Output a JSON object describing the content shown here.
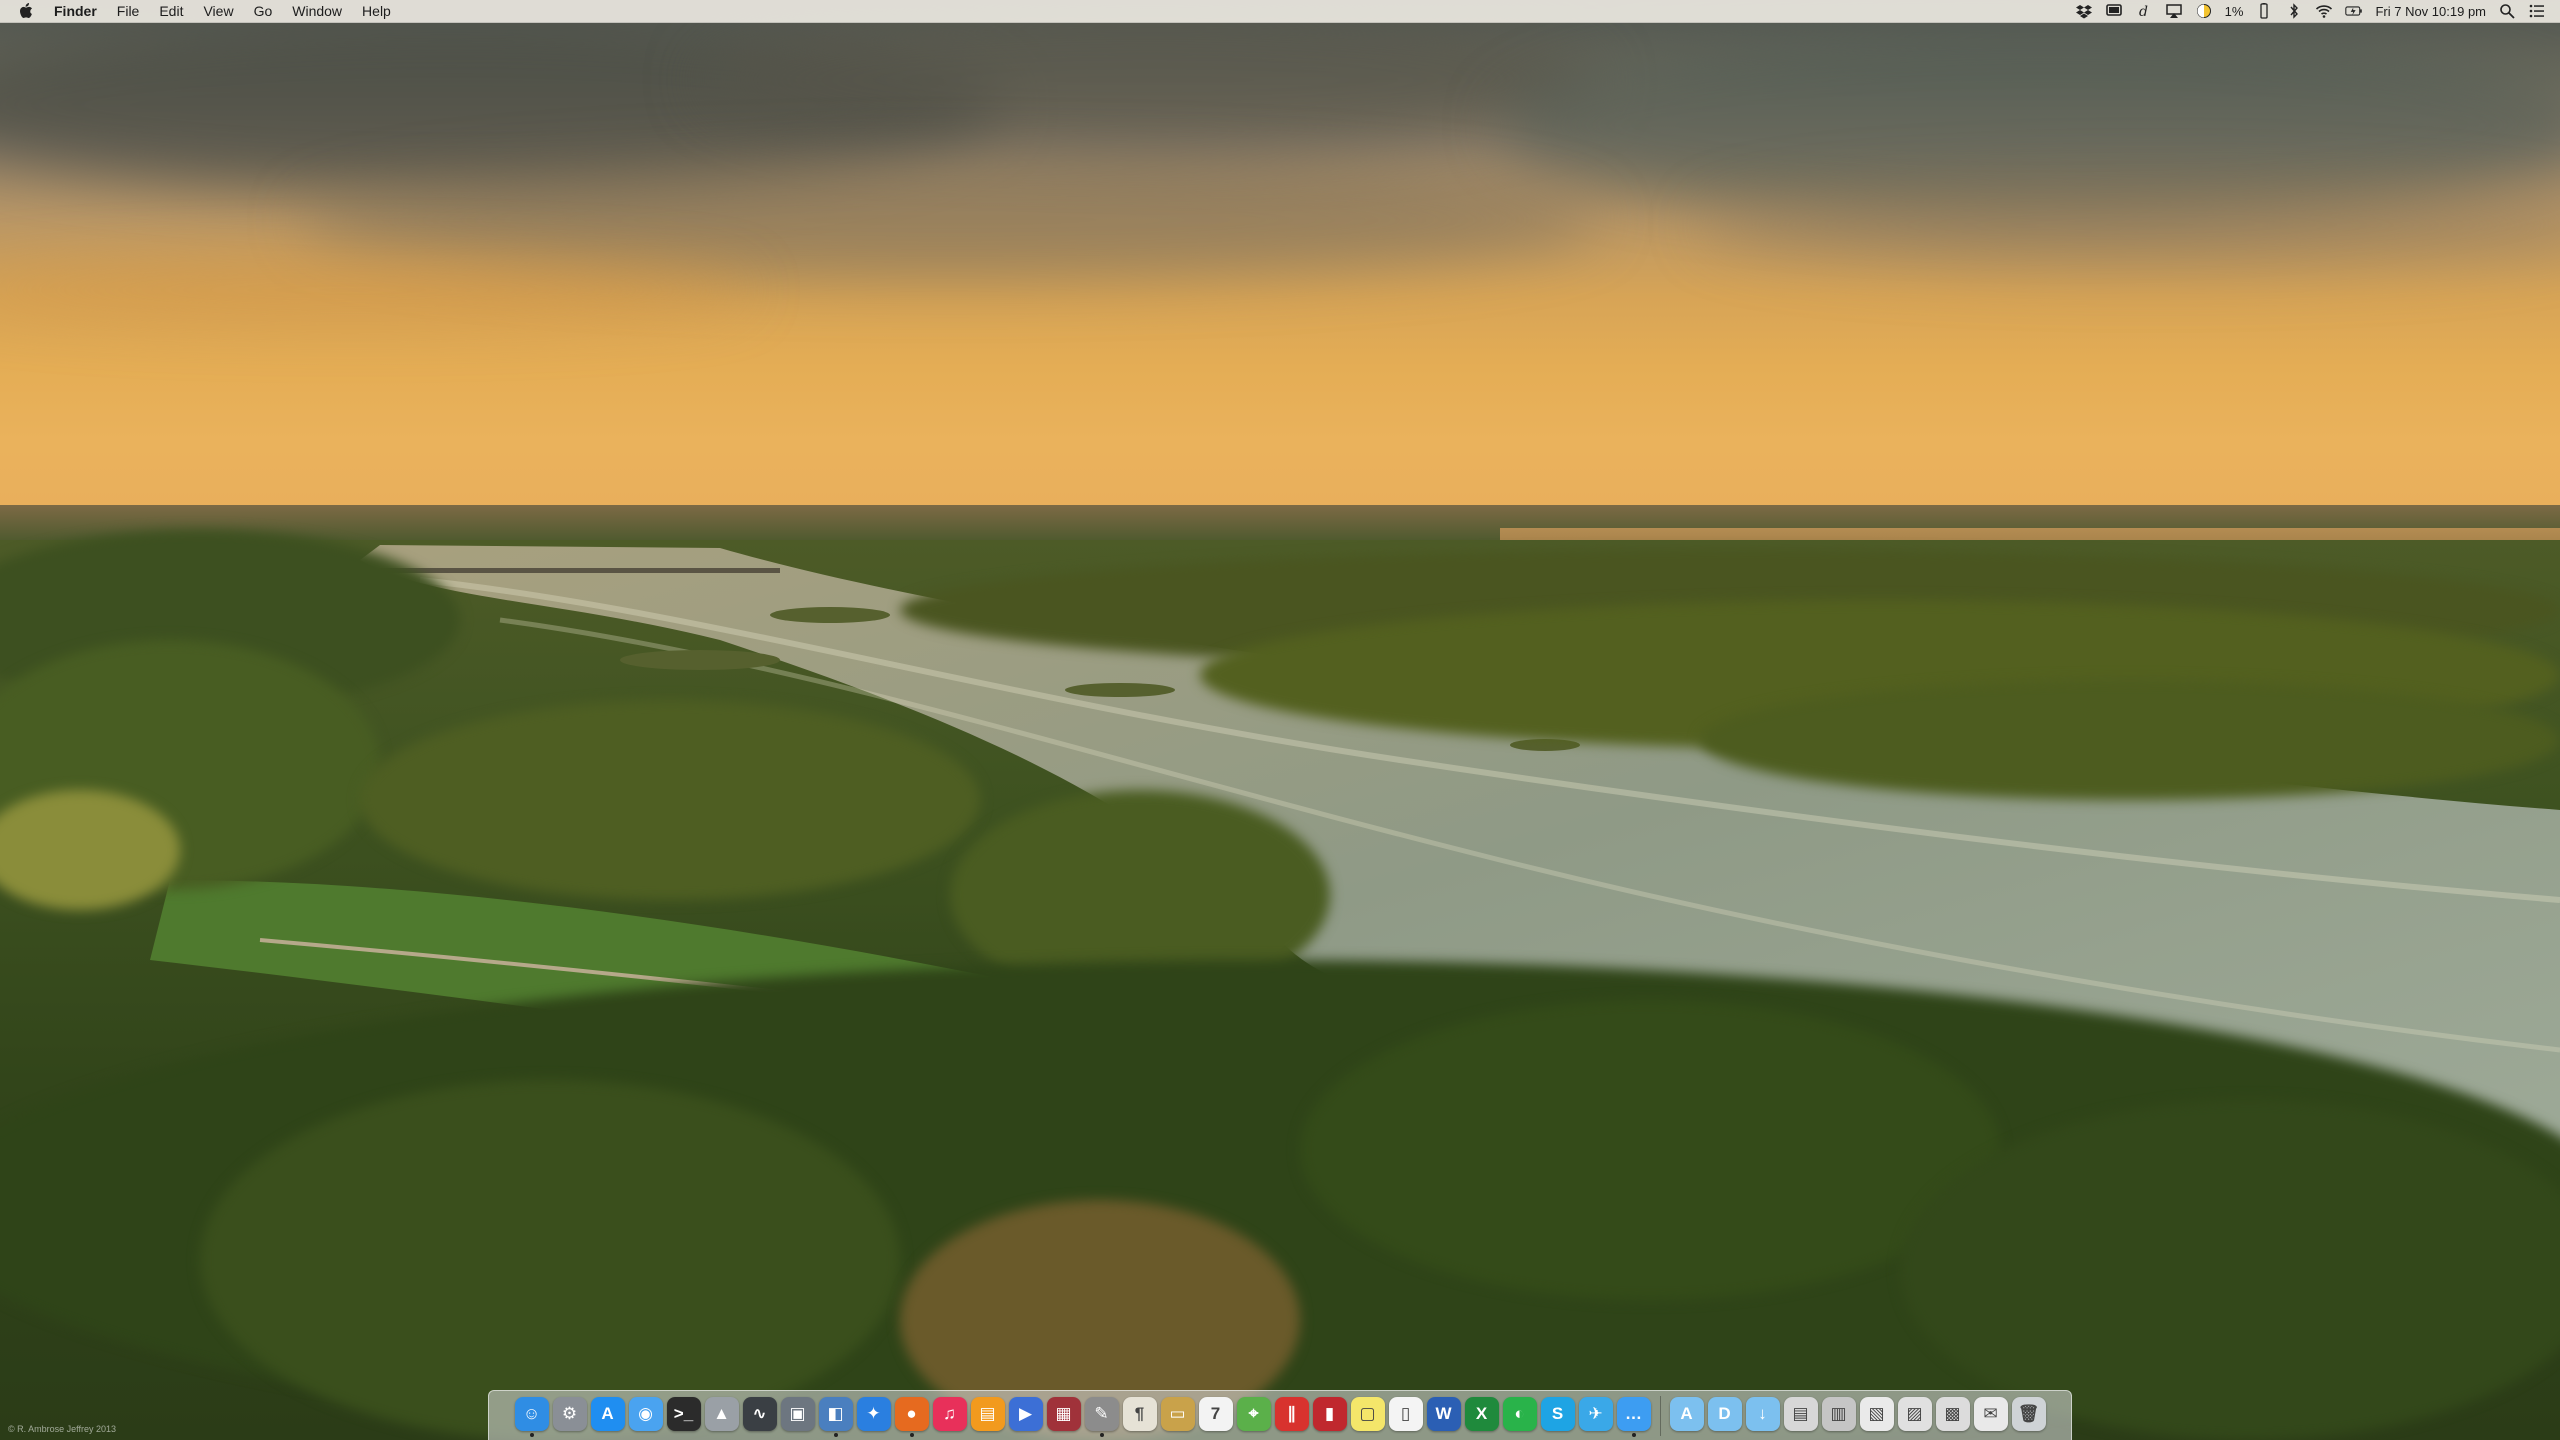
{
  "menubar": {
    "app_name": "Finder",
    "menus": [
      "File",
      "Edit",
      "View",
      "Go",
      "Window",
      "Help"
    ],
    "status": {
      "battery_percent_label": "1%",
      "datetime": "Fri 7 Nov  10:19 pm"
    },
    "status_icons": [
      "dropbox-icon",
      "display-icon",
      "dictionary-icon",
      "airplay-icon",
      "caffeine-icon",
      "battery-icon",
      "bluetooth-icon",
      "wifi-icon",
      "battery-charge-icon",
      "spotlight-icon",
      "notification-center-icon"
    ]
  },
  "wallpaper": {
    "credit": "© R. Ambrose Jeffrey 2013"
  },
  "dock": {
    "apps": [
      {
        "name": "finder-icon",
        "glyph": "☺",
        "color": "#2f8de4",
        "running": true
      },
      {
        "name": "system-preferences-icon",
        "glyph": "⚙",
        "color": "#8a8f96",
        "running": false
      },
      {
        "name": "app-store-icon",
        "glyph": "A",
        "color": "#1f8ef1",
        "running": false
      },
      {
        "name": "wireless-diagnostics-icon",
        "glyph": "◉",
        "color": "#4aa3f0",
        "running": false
      },
      {
        "name": "terminal-icon",
        "glyph": ">_",
        "color": "#2b2b2b",
        "running": false
      },
      {
        "name": "automator-icon",
        "glyph": "▲",
        "color": "#9aa0a6",
        "running": false
      },
      {
        "name": "activity-monitor-icon",
        "glyph": "∿",
        "color": "#3a3f44",
        "running": false
      },
      {
        "name": "image-capture-icon",
        "glyph": "▣",
        "color": "#6d7680",
        "running": false
      },
      {
        "name": "preview-icon",
        "glyph": "◧",
        "color": "#4a7fbf",
        "running": true
      },
      {
        "name": "safari-icon",
        "glyph": "✦",
        "color": "#2a7fe0",
        "running": false
      },
      {
        "name": "firefox-icon",
        "glyph": "●",
        "color": "#e66a1f",
        "running": true
      },
      {
        "name": "itunes-icon",
        "glyph": "♫",
        "color": "#e8305a",
        "running": false
      },
      {
        "name": "ibooks-icon",
        "glyph": "▤",
        "color": "#f29a1e",
        "running": false
      },
      {
        "name": "quicktime-icon",
        "glyph": "▶",
        "color": "#3c6fd6",
        "running": false
      },
      {
        "name": "photo-booth-icon",
        "glyph": "▦",
        "color": "#a0323a",
        "running": false
      },
      {
        "name": "utility-icon",
        "glyph": "✎",
        "color": "#8c8c8c",
        "running": true
      },
      {
        "name": "textedit-icon",
        "glyph": "¶",
        "color": "#e6e2d6",
        "running": false
      },
      {
        "name": "notes-icon",
        "glyph": "▭",
        "color": "#c9a24a",
        "running": false
      },
      {
        "name": "calendar-icon",
        "glyph": "7",
        "color": "#f3f3f3",
        "running": false
      },
      {
        "name": "maps-icon",
        "glyph": "⌖",
        "color": "#5bb04a",
        "running": false
      },
      {
        "name": "parallels-icon",
        "glyph": "∥",
        "color": "#d8322e",
        "running": false
      },
      {
        "name": "books-red-icon",
        "glyph": "▮",
        "color": "#c0282e",
        "running": false
      },
      {
        "name": "stickies-icon",
        "glyph": "▢",
        "color": "#f4e66a",
        "running": false
      },
      {
        "name": "pages-doc-icon",
        "glyph": "▯",
        "color": "#f4f4f4",
        "running": false
      },
      {
        "name": "word-icon",
        "glyph": "W",
        "color": "#2b5fb4",
        "running": false
      },
      {
        "name": "excel-icon",
        "glyph": "X",
        "color": "#1f8a3c",
        "running": false
      },
      {
        "name": "facetime-icon",
        "glyph": "◐",
        "color": "#29b34a",
        "running": false
      },
      {
        "name": "skype-icon",
        "glyph": "S",
        "color": "#1ea4e4",
        "running": false
      },
      {
        "name": "twitter-icon",
        "glyph": "✈",
        "color": "#3aa8e8",
        "running": false
      },
      {
        "name": "messages-icon",
        "glyph": "…",
        "color": "#3d9df2",
        "running": true
      },
      {
        "name": "applications-folder-icon",
        "glyph": "A",
        "color": "#7cc0ef",
        "running": false
      },
      {
        "name": "documents-folder-icon",
        "glyph": "D",
        "color": "#7cc0ef",
        "running": false
      },
      {
        "name": "downloads-folder-icon",
        "glyph": "↓",
        "color": "#7cc0ef",
        "running": false
      },
      {
        "name": "screenshot-stack-1-icon",
        "glyph": "▤",
        "color": "#d7d7d7",
        "running": false
      },
      {
        "name": "screenshot-stack-2-icon",
        "glyph": "▥",
        "color": "#c5c5c5",
        "running": false
      },
      {
        "name": "document-stack-icon",
        "glyph": "▧",
        "color": "#eaeaea",
        "running": false
      },
      {
        "name": "image-stack-icon",
        "glyph": "▨",
        "color": "#e0e0e0",
        "running": false
      },
      {
        "name": "pdf-stack-icon",
        "glyph": "▩",
        "color": "#dcdcdc",
        "running": false
      },
      {
        "name": "mail-stack-icon",
        "glyph": "✉",
        "color": "#e9e9e9",
        "running": false
      },
      {
        "name": "trash-icon",
        "glyph": "🗑",
        "color": "#cfd3d6",
        "running": false
      }
    ]
  }
}
